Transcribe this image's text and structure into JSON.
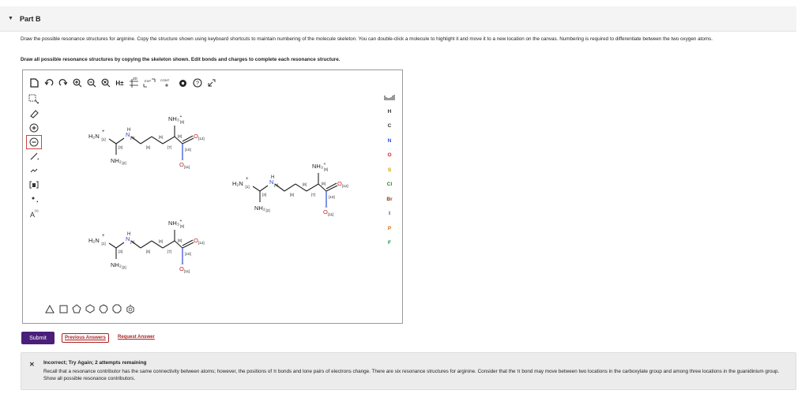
{
  "part": {
    "label": "Part B"
  },
  "question": {
    "prompt": "Draw the possible resonance structures for arginine. Copy the structure shown using keyboard shortcuts to maintain numbering of the molecule skeleton. You can double-click a molecule to highlight it and move it to a new location on the canvas. Numbering is required to differentiate between the two oxygen atoms.",
    "instruction": "Draw all possible resonance structures by copying the skeleton shown. Edit bonds and charges to complete each resonance structure."
  },
  "toolbar": {
    "icons": [
      "new-icon",
      "undo-icon",
      "redo-icon",
      "zoom-in-icon",
      "zoom-out-icon",
      "zoom-fit-icon",
      "hydrogen-icon",
      "2d-icon",
      "exp-icon",
      "cont-icon",
      "settings-icon",
      "help-icon",
      "fullscreen-icon"
    ],
    "labels": {
      "h": "H±",
      "twoD": "2D",
      "exp": "EXP",
      "cont": "CONT"
    }
  },
  "left_tools": [
    "select-icon",
    "eraser-icon",
    "plus-charge-icon",
    "minus-charge-icon",
    "single-bond-icon",
    "chain-icon",
    "bracket-icon",
    "radical-icon",
    "atom-map-icon"
  ],
  "elements": [
    "H",
    "C",
    "N",
    "O",
    "S",
    "Cl",
    "Br",
    "I",
    "P",
    "F"
  ],
  "element_colors": {
    "H": "#333333",
    "C": "#333333",
    "N": "#2a4bd7",
    "O": "#cc2222",
    "S": "#cc9a00",
    "Cl": "#1b8a1b",
    "Br": "#8a3a1a",
    "I": "#6a1a8a",
    "P": "#d86a00",
    "F": "#1b8a4a"
  },
  "periodic_label": "periodic-table",
  "molecules": {
    "labels": {
      "nh3": "NH₃",
      "nh3_num": "[9]",
      "h2n": "H₂N",
      "h2n_num": "[1]",
      "nh2": "NH₂",
      "nh2_num": "[2]",
      "nh2plus": "NH₂",
      "nh2plus_num": "[2]",
      "n4": "N",
      "n4_num": "[4]",
      "h": "H",
      "c3": "[3]",
      "c5": "[5]",
      "c6": "[6]",
      "c7": "[7]",
      "c8": "[8]",
      "c10": "[10]",
      "o12": "O",
      "o12_num": "[12]",
      "o11": "O",
      "o11_num": "[11]",
      "plus": "+",
      "minus": "−",
      "dot": "."
    }
  },
  "shapes": [
    "triangle-icon",
    "square-icon",
    "pentagon-icon",
    "hexagon-icon",
    "heptagon-icon",
    "octagon-icon",
    "benzene-icon"
  ],
  "actions": {
    "submit": "Submit",
    "previous_answers": "Previous Answers",
    "request_answer": "Request Answer"
  },
  "feedback": {
    "title": "Incorrect; Try Again; 2 attempts remaining",
    "text": "Recall that a resonance contributor has the same connectivity between atoms; however, the positions of π bonds and lone pairs of electrons change. There are six resonance structures for arginine. Consider that the π bond may move between two locations in the carboxylate group and among three locations in the guanidinium group. Show all possible resonance contributors."
  },
  "colors": {
    "submit_bg": "#4a1f7a",
    "link": "#aa2222",
    "nitrogen": "#2a4bd7",
    "oxygen": "#cc2222"
  }
}
